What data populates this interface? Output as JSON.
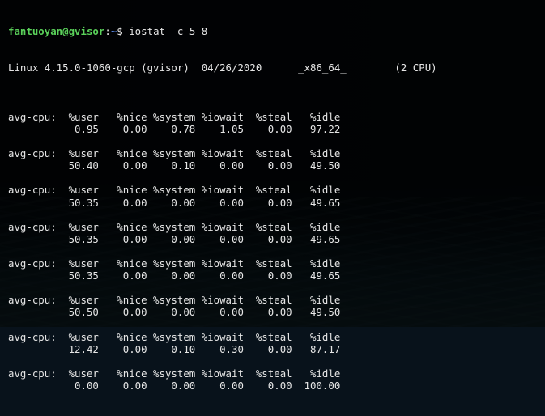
{
  "terminal": {
    "prompt": {
      "userhost": "fantuoyan@gvisor",
      "separator": ":",
      "path": "~",
      "symbol": "$",
      "command": " iostat -c 5 8"
    },
    "sysinfo": "Linux 4.15.0-1060-gcp (gvisor)  04/26/2020      _x86_64_        (2 CPU)",
    "header": "avg-cpu:  %user   %nice %system %iowait  %steal   %idle",
    "blocks": [
      {
        "values": "           0.95    0.00    0.78    1.05    0.00   97.22"
      },
      {
        "values": "          50.40    0.00    0.10    0.00    0.00   49.50"
      },
      {
        "values": "          50.35    0.00    0.00    0.00    0.00   49.65"
      },
      {
        "values": "          50.35    0.00    0.00    0.00    0.00   49.65"
      },
      {
        "values": "          50.35    0.00    0.00    0.00    0.00   49.65"
      },
      {
        "values": "          50.50    0.00    0.00    0.00    0.00   49.50"
      },
      {
        "values": "          12.42    0.00    0.10    0.30    0.00   87.17"
      },
      {
        "values": "           0.00    0.00    0.00    0.00    0.00  100.00"
      }
    ]
  },
  "colors": {
    "prompt_user": "#5ad15a",
    "prompt_path": "#5b8def",
    "text": "#e6e6e6"
  }
}
